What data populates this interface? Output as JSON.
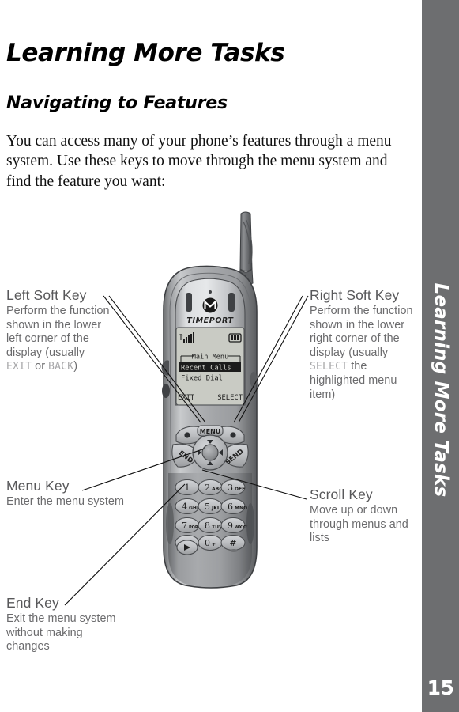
{
  "document": {
    "title": "Learning More Tasks",
    "section_heading": "Navigating to Features",
    "intro_paragraph": "You can access many of your phone’s features through a menu system. Use these keys to move through the menu system and find the feature you want:",
    "page_number": "15",
    "side_tab_label": "Learning More Tasks",
    "side_tab_color": "#6d6e70",
    "heading_color": "#000000",
    "annotation_title_color": "#58585a",
    "annotation_body_color": "#6b6b6d",
    "keyword_color": "#a6a6a8"
  },
  "annotations": {
    "left_soft_key": {
      "title": "Left Soft Key",
      "body_before": "Perform the function shown in the lower left corner of the display (usually ",
      "keyword_1": "EXIT",
      "body_middle": " or ",
      "keyword_2": "BACK",
      "body_after": ")"
    },
    "right_soft_key": {
      "title": "Right Soft Key",
      "body_before": "Perform the function shown in the lower right corner of the display (usually ",
      "keyword_1": "SELECT",
      "body_after": " the highlighted menu item)"
    },
    "menu_key": {
      "title": "Menu Key",
      "body": "Enter the menu system"
    },
    "end_key": {
      "title": "End Key",
      "body": "Exit the menu system without making changes"
    },
    "scroll_key": {
      "title": "Scroll Key",
      "body": "Move up or down through menus and lists"
    }
  },
  "phone": {
    "brand": "MOTOROLA",
    "model_name": "TIMEPORT",
    "display": {
      "menu_title": "Main Menu",
      "items": [
        {
          "label": "Recent Calls",
          "highlighted": true
        },
        {
          "label": "Fixed Dial",
          "highlighted": false
        }
      ],
      "left_softkey_label": "EXIT",
      "right_softkey_label": "SELECT",
      "signal_icon": "signal-bars-icon",
      "battery_icon": "battery-icon",
      "screen_color": "#c9cbc4"
    },
    "keys": {
      "menu_label": "MENU",
      "end_label": "END",
      "send_label": "SEND",
      "keypad": [
        {
          "digit": "1",
          "letters": ""
        },
        {
          "digit": "2",
          "letters": "ABC"
        },
        {
          "digit": "3",
          "letters": "DEF"
        },
        {
          "digit": "4",
          "letters": "GHI"
        },
        {
          "digit": "5",
          "letters": "JKL"
        },
        {
          "digit": "6",
          "letters": "MNO"
        },
        {
          "digit": "7",
          "letters": "PQRS"
        },
        {
          "digit": "8",
          "letters": "TUV"
        },
        {
          "digit": "9",
          "letters": "WXYZ"
        },
        {
          "digit": "∗",
          "letters": ""
        },
        {
          "digit": "0",
          "letters": "+"
        },
        {
          "digit": "#",
          "letters": ""
        }
      ],
      "voice_key_icon": "play-triangle-icon"
    }
  }
}
